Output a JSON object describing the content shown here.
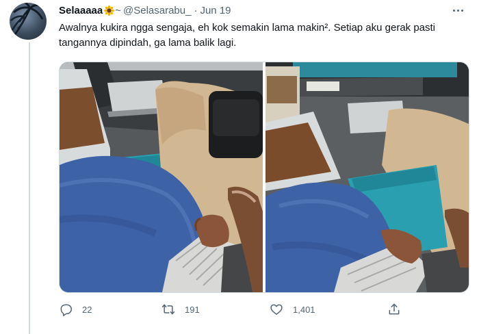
{
  "tweet": {
    "display_name": "Selaaaaa",
    "handle": "@Selasarabu_",
    "separator": "·",
    "time": "Jun 19",
    "text": "Awalnya kukira ngga sengaja, eh kok semakin lama makin². Setiap aku gerak pasti tangannya dipindah, ga lama balik lagi."
  },
  "icons": {
    "name_emoji": "sunflower-icon",
    "tilde": "~",
    "more": "more-options-icon",
    "reply": "reply-icon",
    "retweet": "retweet-icon",
    "like": "like-icon",
    "share": "share-icon"
  },
  "actions": {
    "reply_count": "22",
    "retweet_count": "191",
    "like_count": "1,401"
  },
  "colors": {
    "text_primary": "#0f1419",
    "text_secondary": "#536471",
    "border": "#cfd9de"
  }
}
